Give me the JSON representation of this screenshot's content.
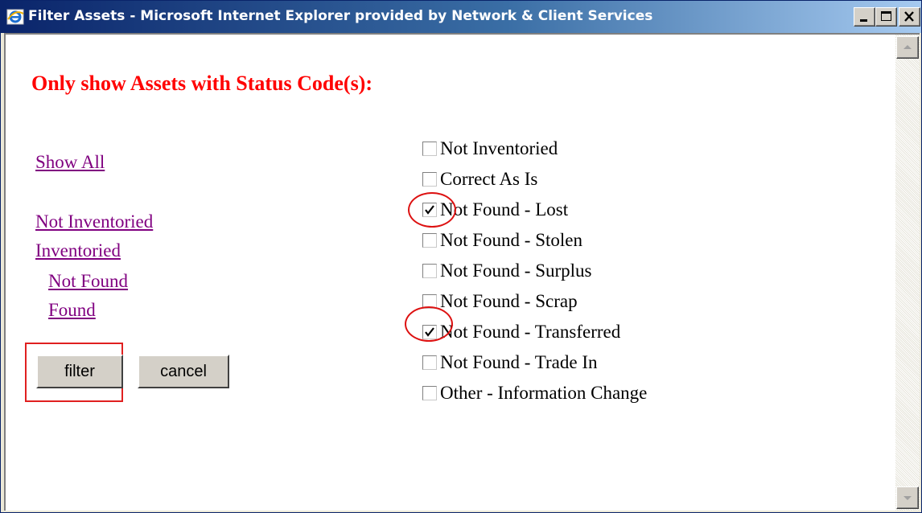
{
  "window": {
    "title": "Filter Assets - Microsoft Internet Explorer provided by Network & Client Services"
  },
  "page": {
    "heading": "Only show Assets with Status Code(s):"
  },
  "links": {
    "show_all": "Show All",
    "not_inventoried": "Not Inventoried",
    "inventoried": "Inventoried",
    "not_found": "Not Found",
    "found": "Found"
  },
  "buttons": {
    "filter": "filter",
    "cancel": "cancel"
  },
  "status_codes": [
    {
      "label": "Not Inventoried",
      "checked": false
    },
    {
      "label": "Correct As Is",
      "checked": false
    },
    {
      "label": "Not Found - Lost",
      "checked": true
    },
    {
      "label": "Not Found - Stolen",
      "checked": false
    },
    {
      "label": "Not Found - Surplus",
      "checked": false
    },
    {
      "label": "Not Found - Scrap",
      "checked": false
    },
    {
      "label": "Not Found - Transferred",
      "checked": true
    },
    {
      "label": "Not Found - Trade In",
      "checked": false
    },
    {
      "label": "Other - Information Change",
      "checked": false
    }
  ],
  "colors": {
    "heading": "#ff0000",
    "link_visited": "#800080",
    "annotation": "#dd1111"
  }
}
